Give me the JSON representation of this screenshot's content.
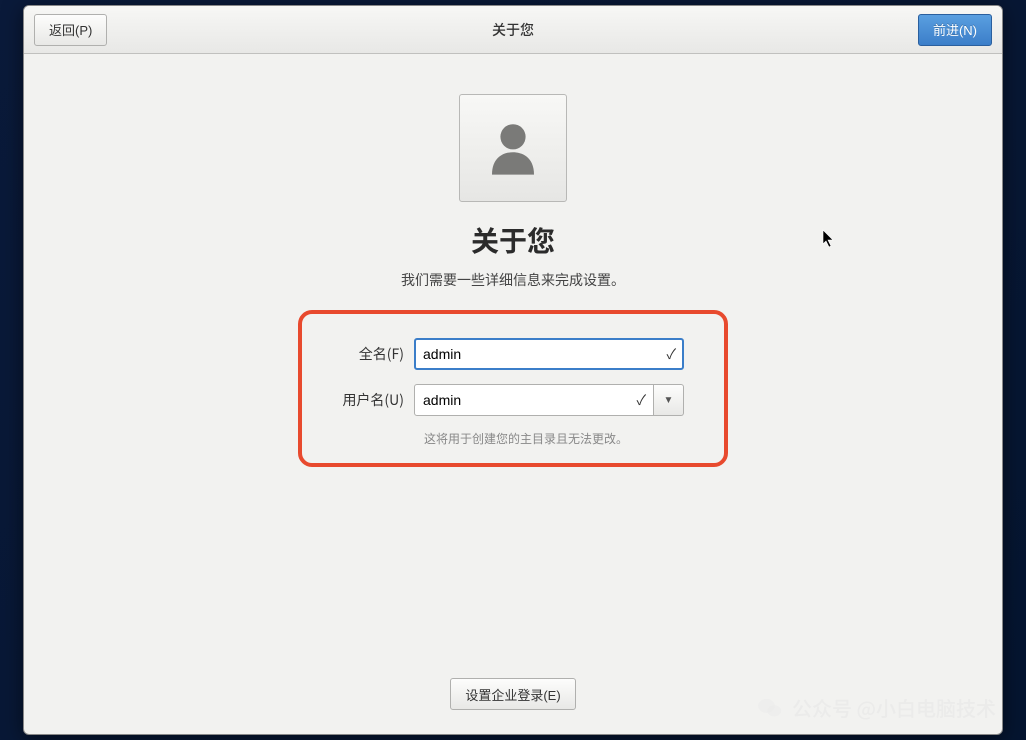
{
  "titlebar": {
    "back_label": "返回(P)",
    "title": "关于您",
    "forward_label": "前进(N)"
  },
  "page": {
    "headline": "关于您",
    "subhead": "我们需要一些详细信息来完成设置。"
  },
  "form": {
    "fullname_label": "全名(F)",
    "fullname_value": "admin",
    "username_label": "用户名(U)",
    "username_value": "admin",
    "username_hint": "这将用于创建您的主目录且无法更改。"
  },
  "footer": {
    "enterprise_login_label": "设置企业登录(E)"
  },
  "watermark": {
    "text": "公众号 @小白电脑技术"
  }
}
